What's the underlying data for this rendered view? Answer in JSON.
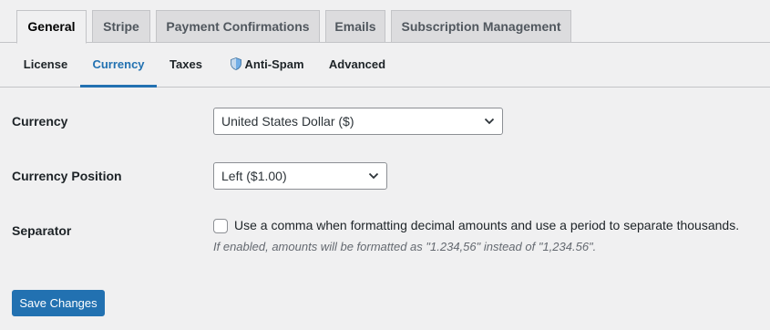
{
  "primary_tabs": [
    {
      "label": "General",
      "active": true
    },
    {
      "label": "Stripe",
      "active": false
    },
    {
      "label": "Payment Confirmations",
      "active": false
    },
    {
      "label": "Emails",
      "active": false
    },
    {
      "label": "Subscription Management",
      "active": false
    }
  ],
  "secondary_tabs": [
    {
      "label": "License",
      "active": false,
      "icon": null
    },
    {
      "label": "Currency",
      "active": true,
      "icon": null
    },
    {
      "label": "Taxes",
      "active": false,
      "icon": null
    },
    {
      "label": "Anti-Spam",
      "active": false,
      "icon": "shield-icon"
    },
    {
      "label": "Advanced",
      "active": false,
      "icon": null
    }
  ],
  "form": {
    "currency": {
      "label": "Currency",
      "value": "United States Dollar ($)"
    },
    "currency_position": {
      "label": "Currency Position",
      "value": "Left ($1.00)"
    },
    "separator": {
      "label": "Separator",
      "checkbox_label": "Use a comma when formatting decimal amounts and use a period to separate thousands.",
      "checked": false,
      "description": "If enabled, amounts will be formatted as \"1.234,56\" instead of \"1,234.56\"."
    }
  },
  "actions": {
    "save_label": "Save Changes"
  },
  "colors": {
    "accent": "#2271b1",
    "background": "#f0f0f1",
    "tab_inactive": "#dcdcde",
    "border": "#c3c4c7"
  }
}
